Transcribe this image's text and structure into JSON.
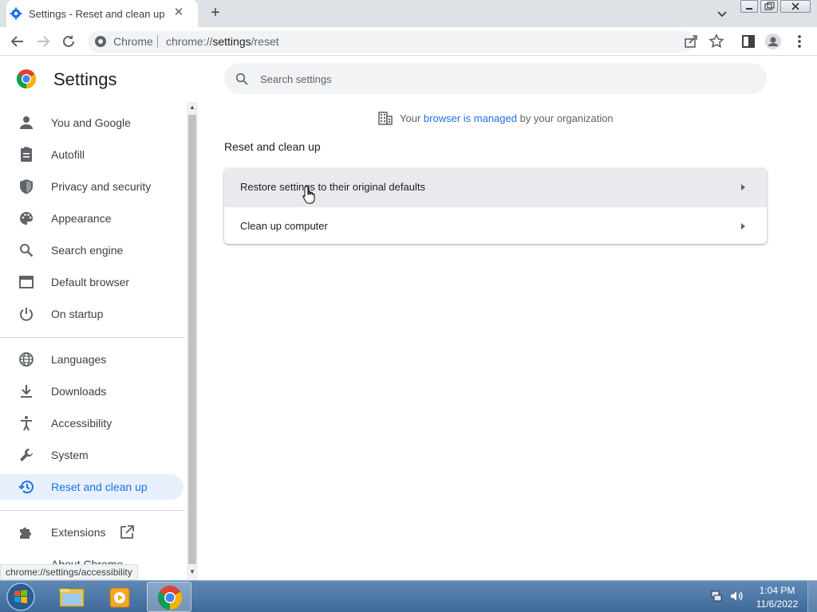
{
  "browser": {
    "tab_title": "Settings - Reset and clean up",
    "new_tab_symbol": "+",
    "close_symbol": "✕",
    "omnibox_chip": "Chrome",
    "url_prefix": "chrome://",
    "url_host": "settings",
    "url_path": "/reset"
  },
  "sidebar": {
    "title": "Settings",
    "items": [
      {
        "label": "You and Google",
        "icon": "person-icon"
      },
      {
        "label": "Autofill",
        "icon": "clipboard-icon"
      },
      {
        "label": "Privacy and security",
        "icon": "shield-icon"
      },
      {
        "label": "Appearance",
        "icon": "palette-icon"
      },
      {
        "label": "Search engine",
        "icon": "search-icon"
      },
      {
        "label": "Default browser",
        "icon": "browser-window-icon"
      },
      {
        "label": "On startup",
        "icon": "power-icon"
      },
      {
        "label": "Languages",
        "icon": "globe-icon"
      },
      {
        "label": "Downloads",
        "icon": "download-icon"
      },
      {
        "label": "Accessibility",
        "icon": "accessibility-icon"
      },
      {
        "label": "System",
        "icon": "wrench-icon"
      },
      {
        "label": "Reset and clean up",
        "icon": "history-icon",
        "active": true
      },
      {
        "label": "Extensions",
        "icon": "puzzle-icon"
      },
      {
        "label": "About Chrome",
        "icon": "chrome-icon"
      }
    ],
    "status_url": "chrome://settings/accessibility"
  },
  "main": {
    "search_placeholder": "Search settings",
    "managed_prefix": "Your",
    "managed_link": "browser is managed",
    "managed_suffix": "by your organization",
    "section_title": "Reset and clean up",
    "rows": [
      {
        "label": "Restore settings to their original defaults"
      },
      {
        "label": "Clean up computer"
      }
    ]
  },
  "taskbar": {
    "time": "1:04 PM",
    "date": "11/6/2022"
  },
  "colors": {
    "accent": "#1a73e8",
    "active_nav_bg": "#e8f0fe",
    "tabstrip_bg": "#dee1e6"
  }
}
